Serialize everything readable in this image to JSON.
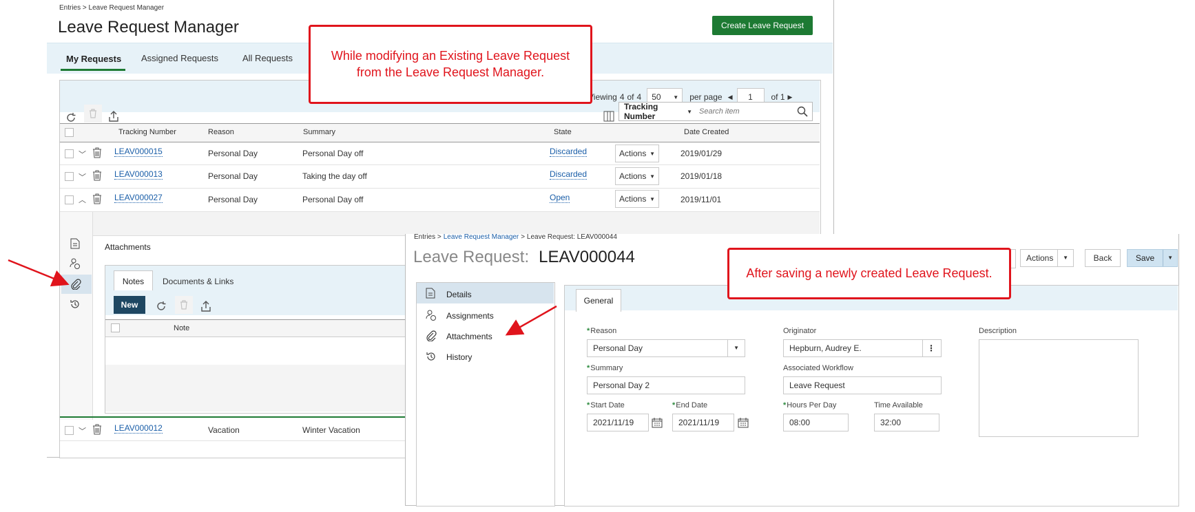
{
  "manager": {
    "breadcrumb": "Entries > Leave Request Manager",
    "title": "Leave Request Manager",
    "create_button": "Create Leave Request",
    "tabs": [
      "My Requests",
      "Assigned Requests",
      "All Requests"
    ],
    "pagination": {
      "viewing_label": "Viewing",
      "viewing_count": "4",
      "of_label": "of",
      "viewing_total": "4",
      "page_size": "50",
      "per_page_label": "per page",
      "page": "1",
      "of_pages": "of 1"
    },
    "search": {
      "field": "Tracking Number",
      "placeholder": "Search item"
    },
    "columns": [
      "Tracking Number",
      "Reason",
      "Summary",
      "State",
      "",
      "Date Created"
    ],
    "rows": [
      {
        "tracking": "LEAV000015",
        "reason": "Personal Day",
        "summary": "Personal Day off",
        "state": "Discarded",
        "actions": "Actions",
        "date": "2019/01/29"
      },
      {
        "tracking": "LEAV000013",
        "reason": "Personal Day",
        "summary": "Taking the day off",
        "state": "Discarded",
        "actions": "Actions",
        "date": "2019/01/18"
      },
      {
        "tracking": "LEAV000027",
        "reason": "Personal Day",
        "summary": "Personal Day off",
        "state": "Open",
        "actions": "Actions",
        "date": "2019/11/01"
      },
      {
        "tracking": "LEAV000012",
        "reason": "Vacation",
        "summary": "Winter Vacation"
      }
    ],
    "attachments": {
      "header": "Attachments",
      "tabs": [
        "Notes",
        "Documents & Links"
      ],
      "new_button": "New",
      "note_column": "Note"
    }
  },
  "detail": {
    "breadcrumb_entries": "Entries >",
    "breadcrumb_manager": "Leave Request Manager",
    "breadcrumb_current": "> Leave Request: LEAV000044",
    "title_label": "Leave Request:",
    "title_id": "LEAV000044",
    "buttons": {
      "actions": "Actions",
      "back": "Back",
      "save": "Save"
    },
    "nav": [
      "Details",
      "Assignments",
      "Attachments",
      "History"
    ],
    "tab": "General",
    "form": {
      "reason_label": "Reason",
      "reason_value": "Personal Day",
      "summary_label": "Summary",
      "summary_value": "Personal Day 2",
      "start_label": "Start Date",
      "start_value": "2021/11/19",
      "end_label": "End Date",
      "end_value": "2021/11/19",
      "originator_label": "Originator",
      "originator_value": "Hepburn, Audrey E.",
      "workflow_label": "Associated Workflow",
      "workflow_value": "Leave Request",
      "hours_label": "Hours Per Day",
      "hours_value": "08:00",
      "time_label": "Time Available",
      "time_value": "32:00",
      "description_label": "Description"
    }
  },
  "callouts": {
    "existing": "While modifying an Existing Leave Request from the Leave Request Manager.",
    "new": "After saving a newly created Leave Request."
  },
  "colors": {
    "accent_green": "#1d7a33",
    "link_blue": "#1a5ea8",
    "callout_red": "#e0141c",
    "header_blue": "#e7f2f8"
  }
}
